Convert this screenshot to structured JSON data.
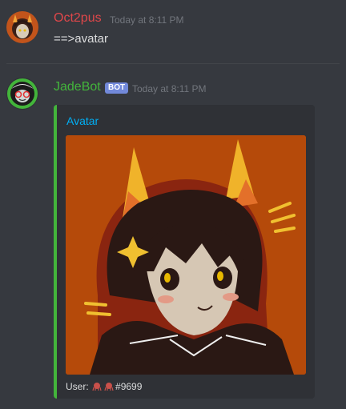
{
  "messages": [
    {
      "username": "Oct2pus",
      "username_color": "#e0474a",
      "timestamp": "Today at 8:11 PM",
      "content": "==>avatar",
      "avatar_icon": "user-avatar-troll-icon"
    },
    {
      "username": "JadeBot",
      "username_color": "#43b53b",
      "bot_tag": "BOT",
      "timestamp": "Today at 8:11 PM",
      "avatar_icon": "bot-avatar-icon",
      "embed": {
        "accent_color": "#43b53b",
        "title": "Avatar",
        "image_icon": "avatar-image-troll-character",
        "footer_prefix": "User:",
        "footer_emoji": "octopus-emoji-icon",
        "footer_suffix": "#9699"
      }
    }
  ],
  "colors": {
    "background": "#36393f",
    "embed_background": "#2f3136",
    "link": "#00aff4",
    "timestamp": "#72767d",
    "bot_tag": "#7289da"
  }
}
